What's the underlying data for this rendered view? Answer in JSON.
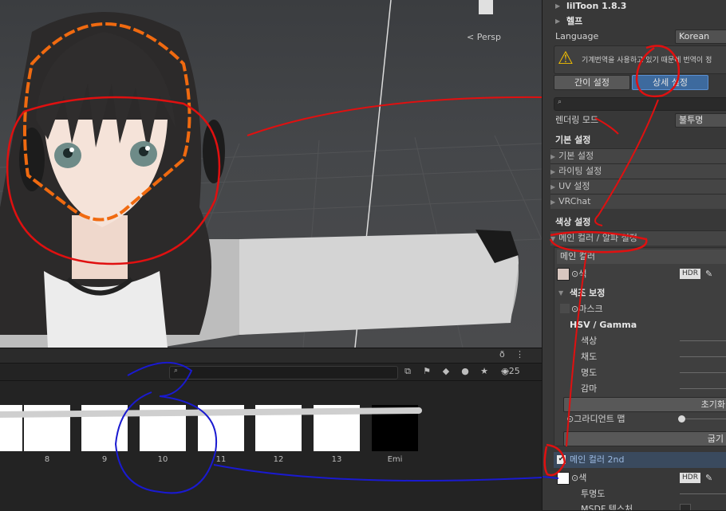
{
  "scene": {
    "view_label": "< Persp"
  },
  "project": {
    "search_placeholder": "",
    "filter_count": "25",
    "assets": [
      {
        "label": "8"
      },
      {
        "label": "9"
      },
      {
        "label": "10"
      },
      {
        "label": "11"
      },
      {
        "label": "12"
      },
      {
        "label": "13"
      },
      {
        "label": "Emi"
      }
    ]
  },
  "inspector": {
    "lil_title": "lilToon 1.8.3",
    "help": "헬프",
    "language_label": "Language",
    "language_value": "Korean",
    "warning_text": "기계번역을 사용하고 있기 때문에 번역이 정",
    "simple_btn": "간이 설정",
    "detail_btn": "상세 설정",
    "render_mode_label": "렌더링 모드",
    "render_mode_value": "불투명",
    "base_settings_heading": "기본 설정",
    "folds": [
      "기본 설정",
      "라이팅 설정",
      "UV 설정",
      "VRChat"
    ],
    "color_heading": "색상 설정",
    "main_color_fold": "메인 컬러 / 알파 설정",
    "main_color_label": "메인 컬러",
    "color_label": "⊙색",
    "hdr": "HDR",
    "tone_heading": "색조 보정",
    "mask_label": "⊙마스크",
    "hsv_heading": "HSV / Gamma",
    "hsv_items": [
      "색상",
      "채도",
      "명도",
      "감마"
    ],
    "reset_btn": "초기화",
    "gradient_label": "⊙그라디언트 맵",
    "bake_btn": "굽기",
    "main2_label": "메인 컬러 2nd",
    "opacity_label": "투명도",
    "msdf_label": "MSDF 텍스처"
  },
  "colors": {
    "accent": "#3d6a9e",
    "annotation_red": "#e01010",
    "annotation_blue": "#1a1ad0",
    "highlight_orange": "#f06a10"
  }
}
